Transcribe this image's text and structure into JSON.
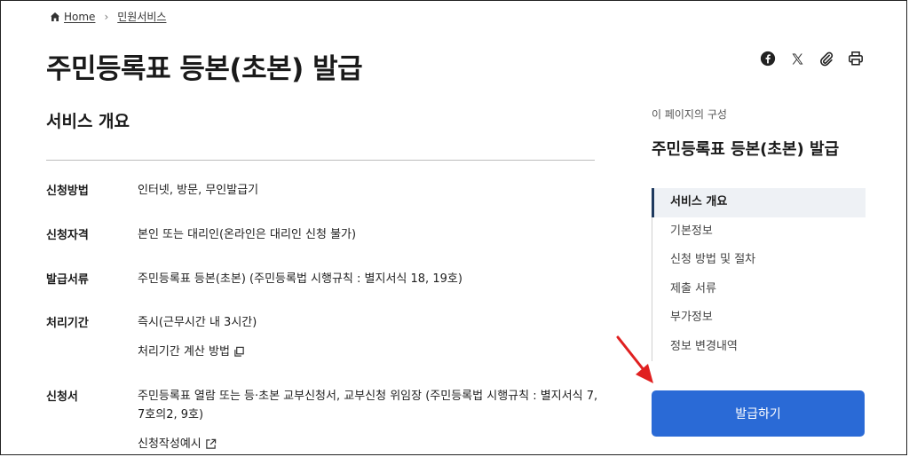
{
  "breadcrumb": {
    "home": "Home",
    "current": "민원서비스"
  },
  "page_title": "주민등록표 등본(초본) 발급",
  "section_title": "서비스 개요",
  "info_rows": [
    {
      "label": "신청방법",
      "value": "인터넷, 방문, 무인발급기"
    },
    {
      "label": "신청자격",
      "value": "본인 또는 대리인(온라인은 대리인 신청 불가)"
    },
    {
      "label": "발급서류",
      "value": "주민등록표 등본(초본) (주민등록법 시행규칙 : 별지서식 18, 19호)"
    },
    {
      "label": "처리기간",
      "value": "즉시(근무시간 내 3시간)",
      "link": "처리기간 계산 방법"
    },
    {
      "label": "신청서",
      "value_line1": "주민등록표 열람 또는 등·초본 교부신청서, 교부신청 위임장 (주민등록법 시행규칙 : 별지서식 7,",
      "value_line2": "7호의2, 9호)",
      "link": "신청작성예시"
    }
  ],
  "toc": {
    "caption": "이 페이지의 구성",
    "title": "주민등록표 등본(초본) 발급",
    "items": [
      "서비스 개요",
      "기본정보",
      "신청 방법 및 절차",
      "제출 서류",
      "부가정보",
      "정보 변경내역"
    ]
  },
  "issue_button": "발급하기",
  "icons": [
    "home-icon",
    "facebook-icon",
    "x-icon",
    "paperclip-icon",
    "print-icon",
    "copy-icon",
    "external-link-icon",
    "red-arrow"
  ],
  "colors": {
    "primary": "#2a6ad6",
    "toc_active_bar": "#1f3a5f",
    "arrow": "#e02020"
  }
}
